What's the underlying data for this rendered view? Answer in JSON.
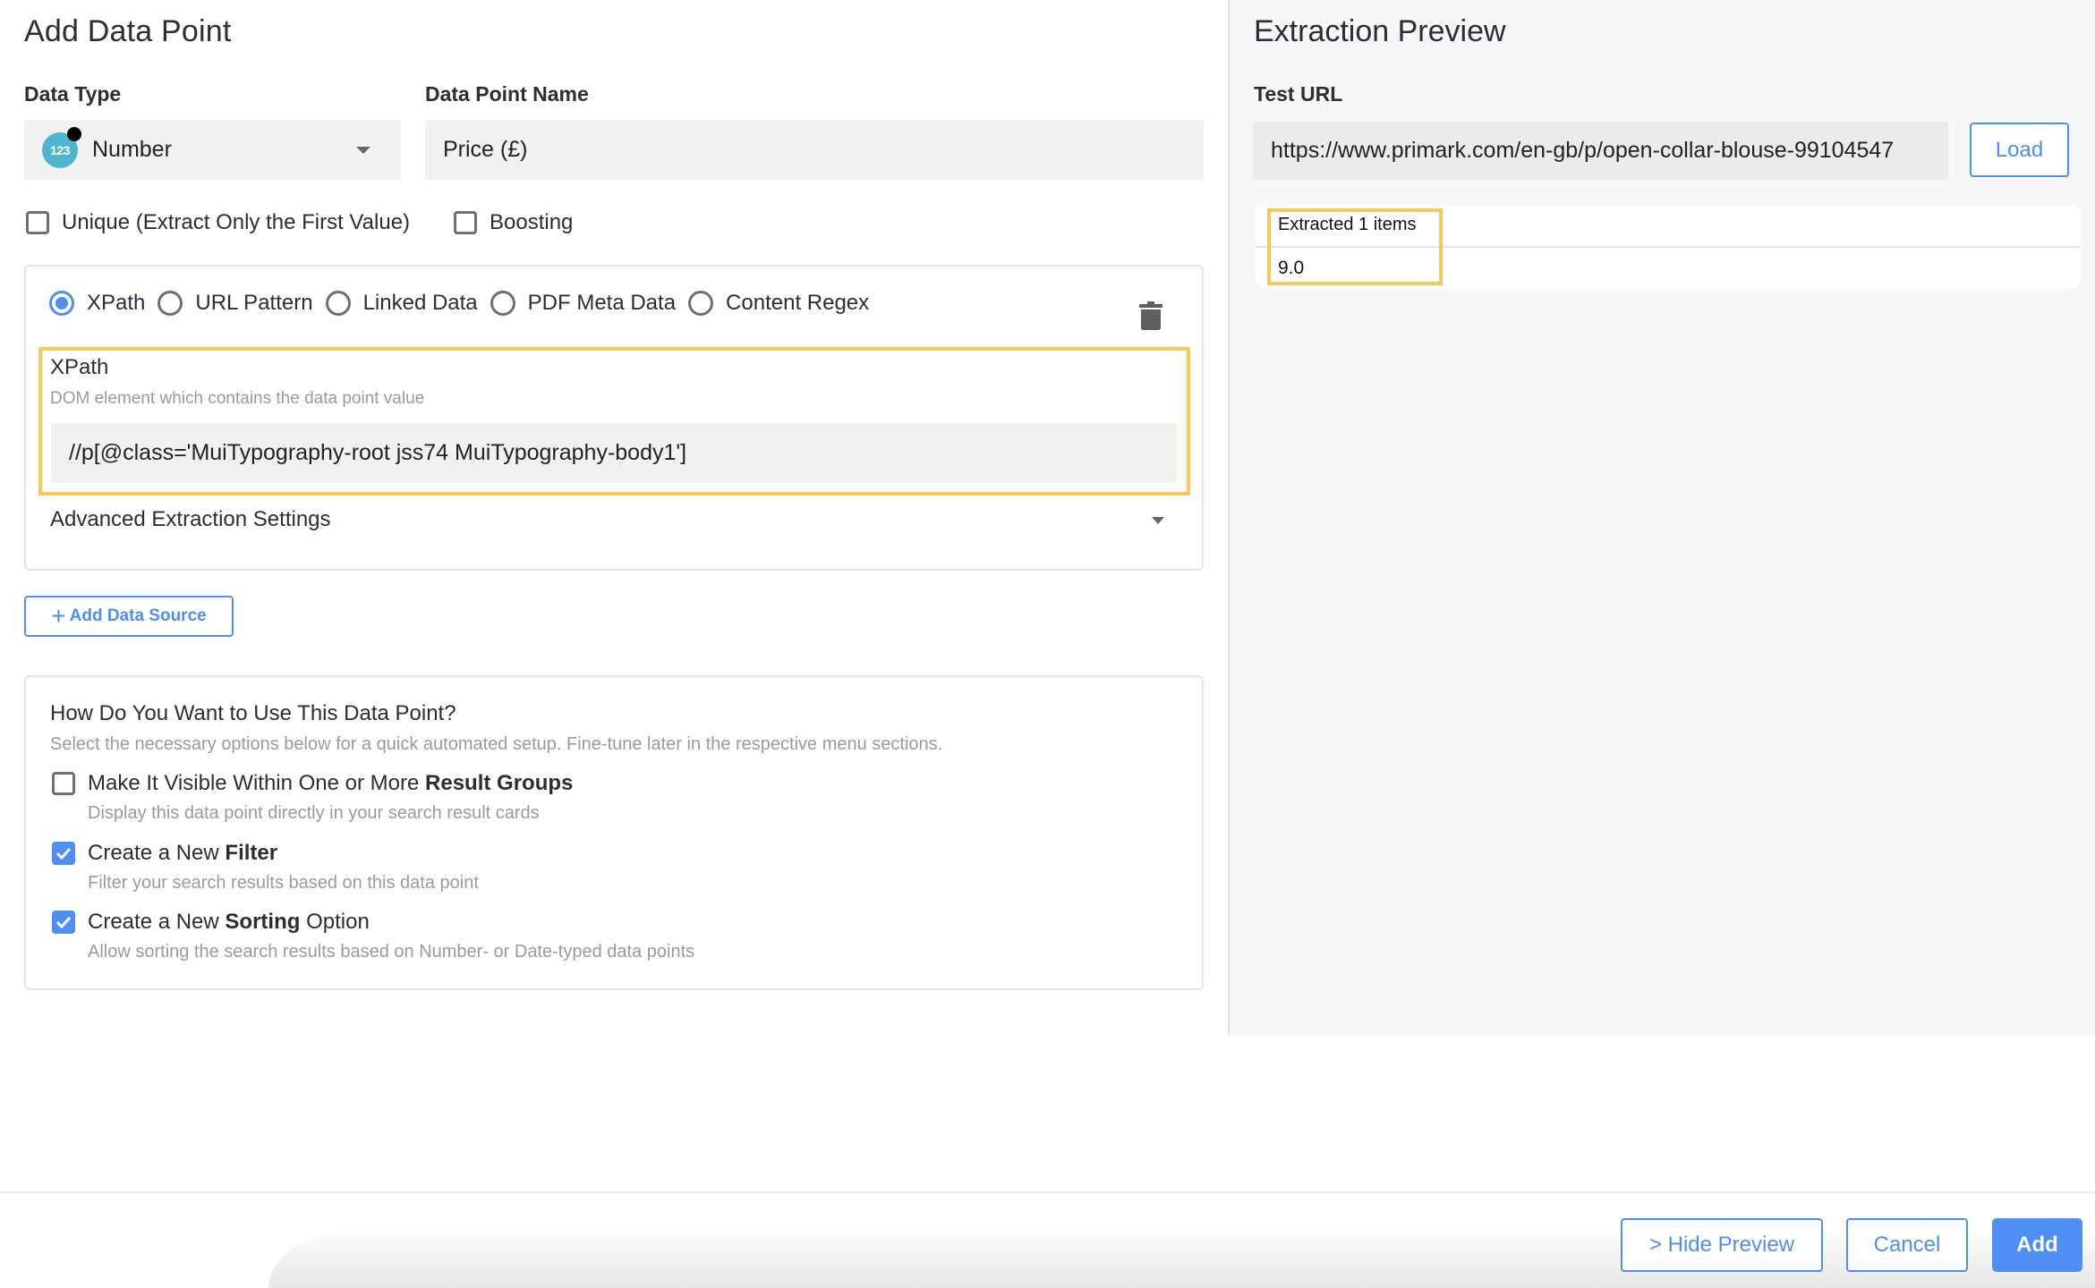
{
  "form": {
    "title": "Add Data Point",
    "data_type": {
      "label": "Data Type",
      "value": "Number",
      "icon": "number-123-icon",
      "icon_text": "123"
    },
    "name": {
      "label": "Data Point Name",
      "value": "Price (£)"
    },
    "options": {
      "unique": {
        "label": "Unique (Extract Only the First Value)",
        "checked": false
      },
      "boosting": {
        "label": "Boosting",
        "checked": false
      }
    },
    "source": {
      "types": [
        {
          "label": "XPath",
          "selected": true
        },
        {
          "label": "URL Pattern",
          "selected": false
        },
        {
          "label": "Linked Data",
          "selected": false
        },
        {
          "label": "PDF Meta Data",
          "selected": false
        },
        {
          "label": "Content Regex",
          "selected": false
        }
      ],
      "xpath_label": "XPath",
      "xpath_help": "DOM element which contains the data point value",
      "xpath_value": "//p[@class='MuiTypography-root jss74 MuiTypography-body1']",
      "advanced_label": "Advanced Extraction Settings",
      "delete_icon": "trash-icon"
    },
    "add_source_label": "Add Data Source",
    "usage": {
      "title": "How Do You Want to Use This Data Point?",
      "subtitle": "Select the necessary options below for a quick automated setup. Fine-tune later in the respective menu sections.",
      "items": [
        {
          "prefix": "Make It Visible Within One or More ",
          "bold": "Result Groups",
          "suffix": "",
          "description": "Display this data point directly in your search result cards",
          "checked": false
        },
        {
          "prefix": "Create a New ",
          "bold": "Filter",
          "suffix": "",
          "description": "Filter your search results based on this data point",
          "checked": true
        },
        {
          "prefix": "Create a New ",
          "bold": "Sorting",
          "suffix": " Option",
          "description": "Allow sorting the search results based on Number- or Date-typed data points",
          "checked": true
        }
      ]
    }
  },
  "preview": {
    "title": "Extraction Preview",
    "test_url_label": "Test URL",
    "test_url_value": "https://www.primark.com/en-gb/p/open-collar-blouse-99104547",
    "load_label": "Load",
    "result_header": "Extracted 1 items",
    "result_values": [
      "9.0"
    ]
  },
  "footer": {
    "hide_preview_label": "> Hide Preview",
    "cancel_label": "Cancel",
    "add_label": "Add"
  },
  "colors": {
    "accent": "#4f8ef2",
    "highlight": "#f5c95a",
    "type_icon": "#4fb6d1"
  }
}
